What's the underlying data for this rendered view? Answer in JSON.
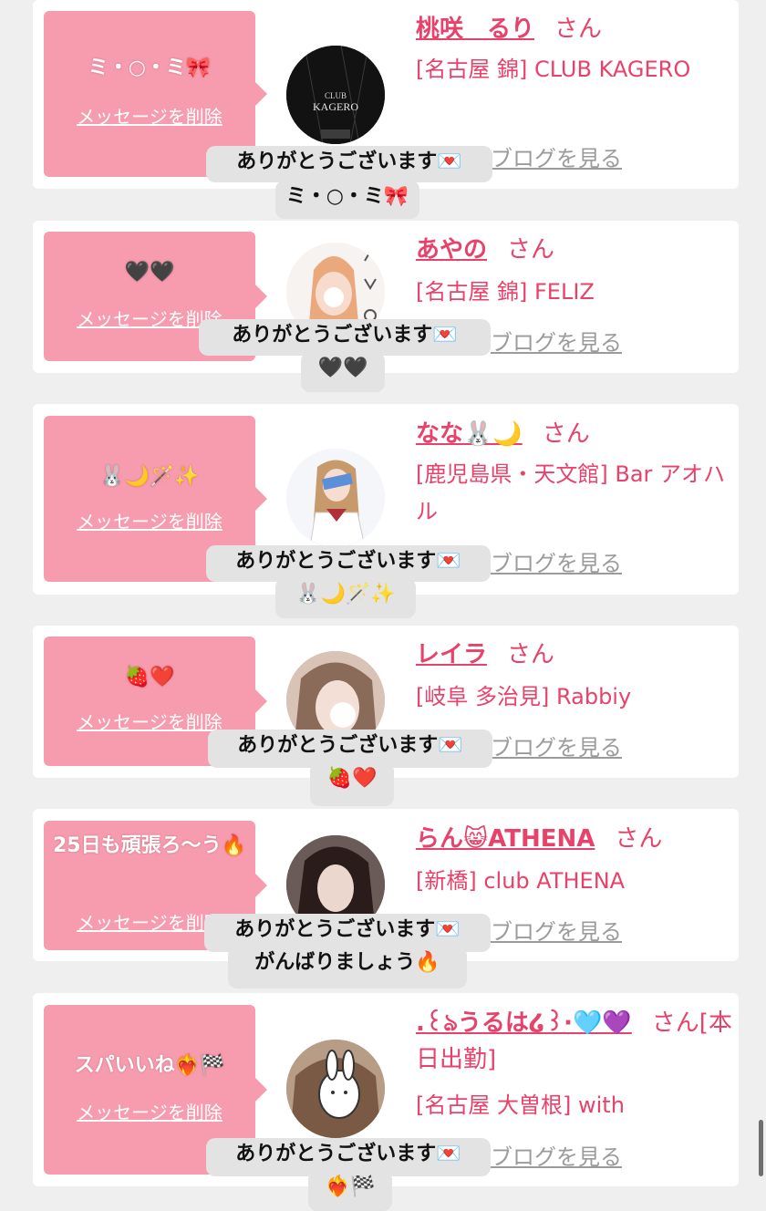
{
  "entries": [
    {
      "bubble_message": "ミ・○・ミ🎀",
      "delete_label": "メッセージを削除",
      "name": "桃咲　るり",
      "san": "さん",
      "shop": "[名古屋 錦] CLUB KAGERO",
      "blog": "ブログを見る",
      "tip_line1": "ありがとうございます💌",
      "tip_line2": "ミ・○・ミ🎀",
      "avatar_text1": "CLUB",
      "avatar_text2": "KAGERO"
    },
    {
      "bubble_message": "🖤🖤",
      "delete_label": "メッセージを削除",
      "name": "あやの",
      "san": "さん",
      "shop": "[名古屋 錦] FELIZ",
      "blog": "ブログを見る",
      "tip_line1": "ありがとうございます💌",
      "tip_line2": "🖤🖤"
    },
    {
      "bubble_message": "🐰🌙🪄✨",
      "delete_label": "メッセージを削除",
      "name": "なな🐰🌙",
      "san": "さん",
      "shop": "[鹿児島県・天文館] Bar アオハル",
      "blog": "ブログを見る",
      "tip_line1": "ありがとうございます💌",
      "tip_line2": "🐰🌙🪄✨"
    },
    {
      "bubble_message": "🍓❤️",
      "delete_label": "メッセージを削除",
      "name": "レイラ",
      "san": "さん",
      "shop": "[岐阜 多治見] Rabbiy",
      "blog": "ブログを見る",
      "tip_line1": "ありがとうございます💌",
      "tip_line2": "🍓❤️"
    },
    {
      "bubble_message": "25日も頑張ろ〜う🔥",
      "delete_label": "メッセージを削除",
      "name": "らん😸ATHENA",
      "san": "さん",
      "shop": "[新橋] club ATHENA",
      "blog": "ブログを見る",
      "tip_line1": "ありがとうございます💌",
      "tip_line2": "がんばりましょう🔥"
    },
    {
      "bubble_message": "スパいいね❤️‍🔥🏁",
      "delete_label": "メッセージを削除",
      "name": ".꒰ঌうるは໒꒱·🩵💜",
      "san": "さん[本日出勤]",
      "shop": "[名古屋 大曽根] with",
      "blog": "ブログを見る",
      "tip_line1": "ありがとうございます💌",
      "tip_line2": "❤️‍🔥🏁"
    }
  ],
  "colors": {
    "accent": "#e8426b",
    "bubble": "#f69cae",
    "card": "#ffffff",
    "background": "#efefef",
    "tooltip": "#e3e3e3",
    "link_gray": "#9b9b9b"
  }
}
